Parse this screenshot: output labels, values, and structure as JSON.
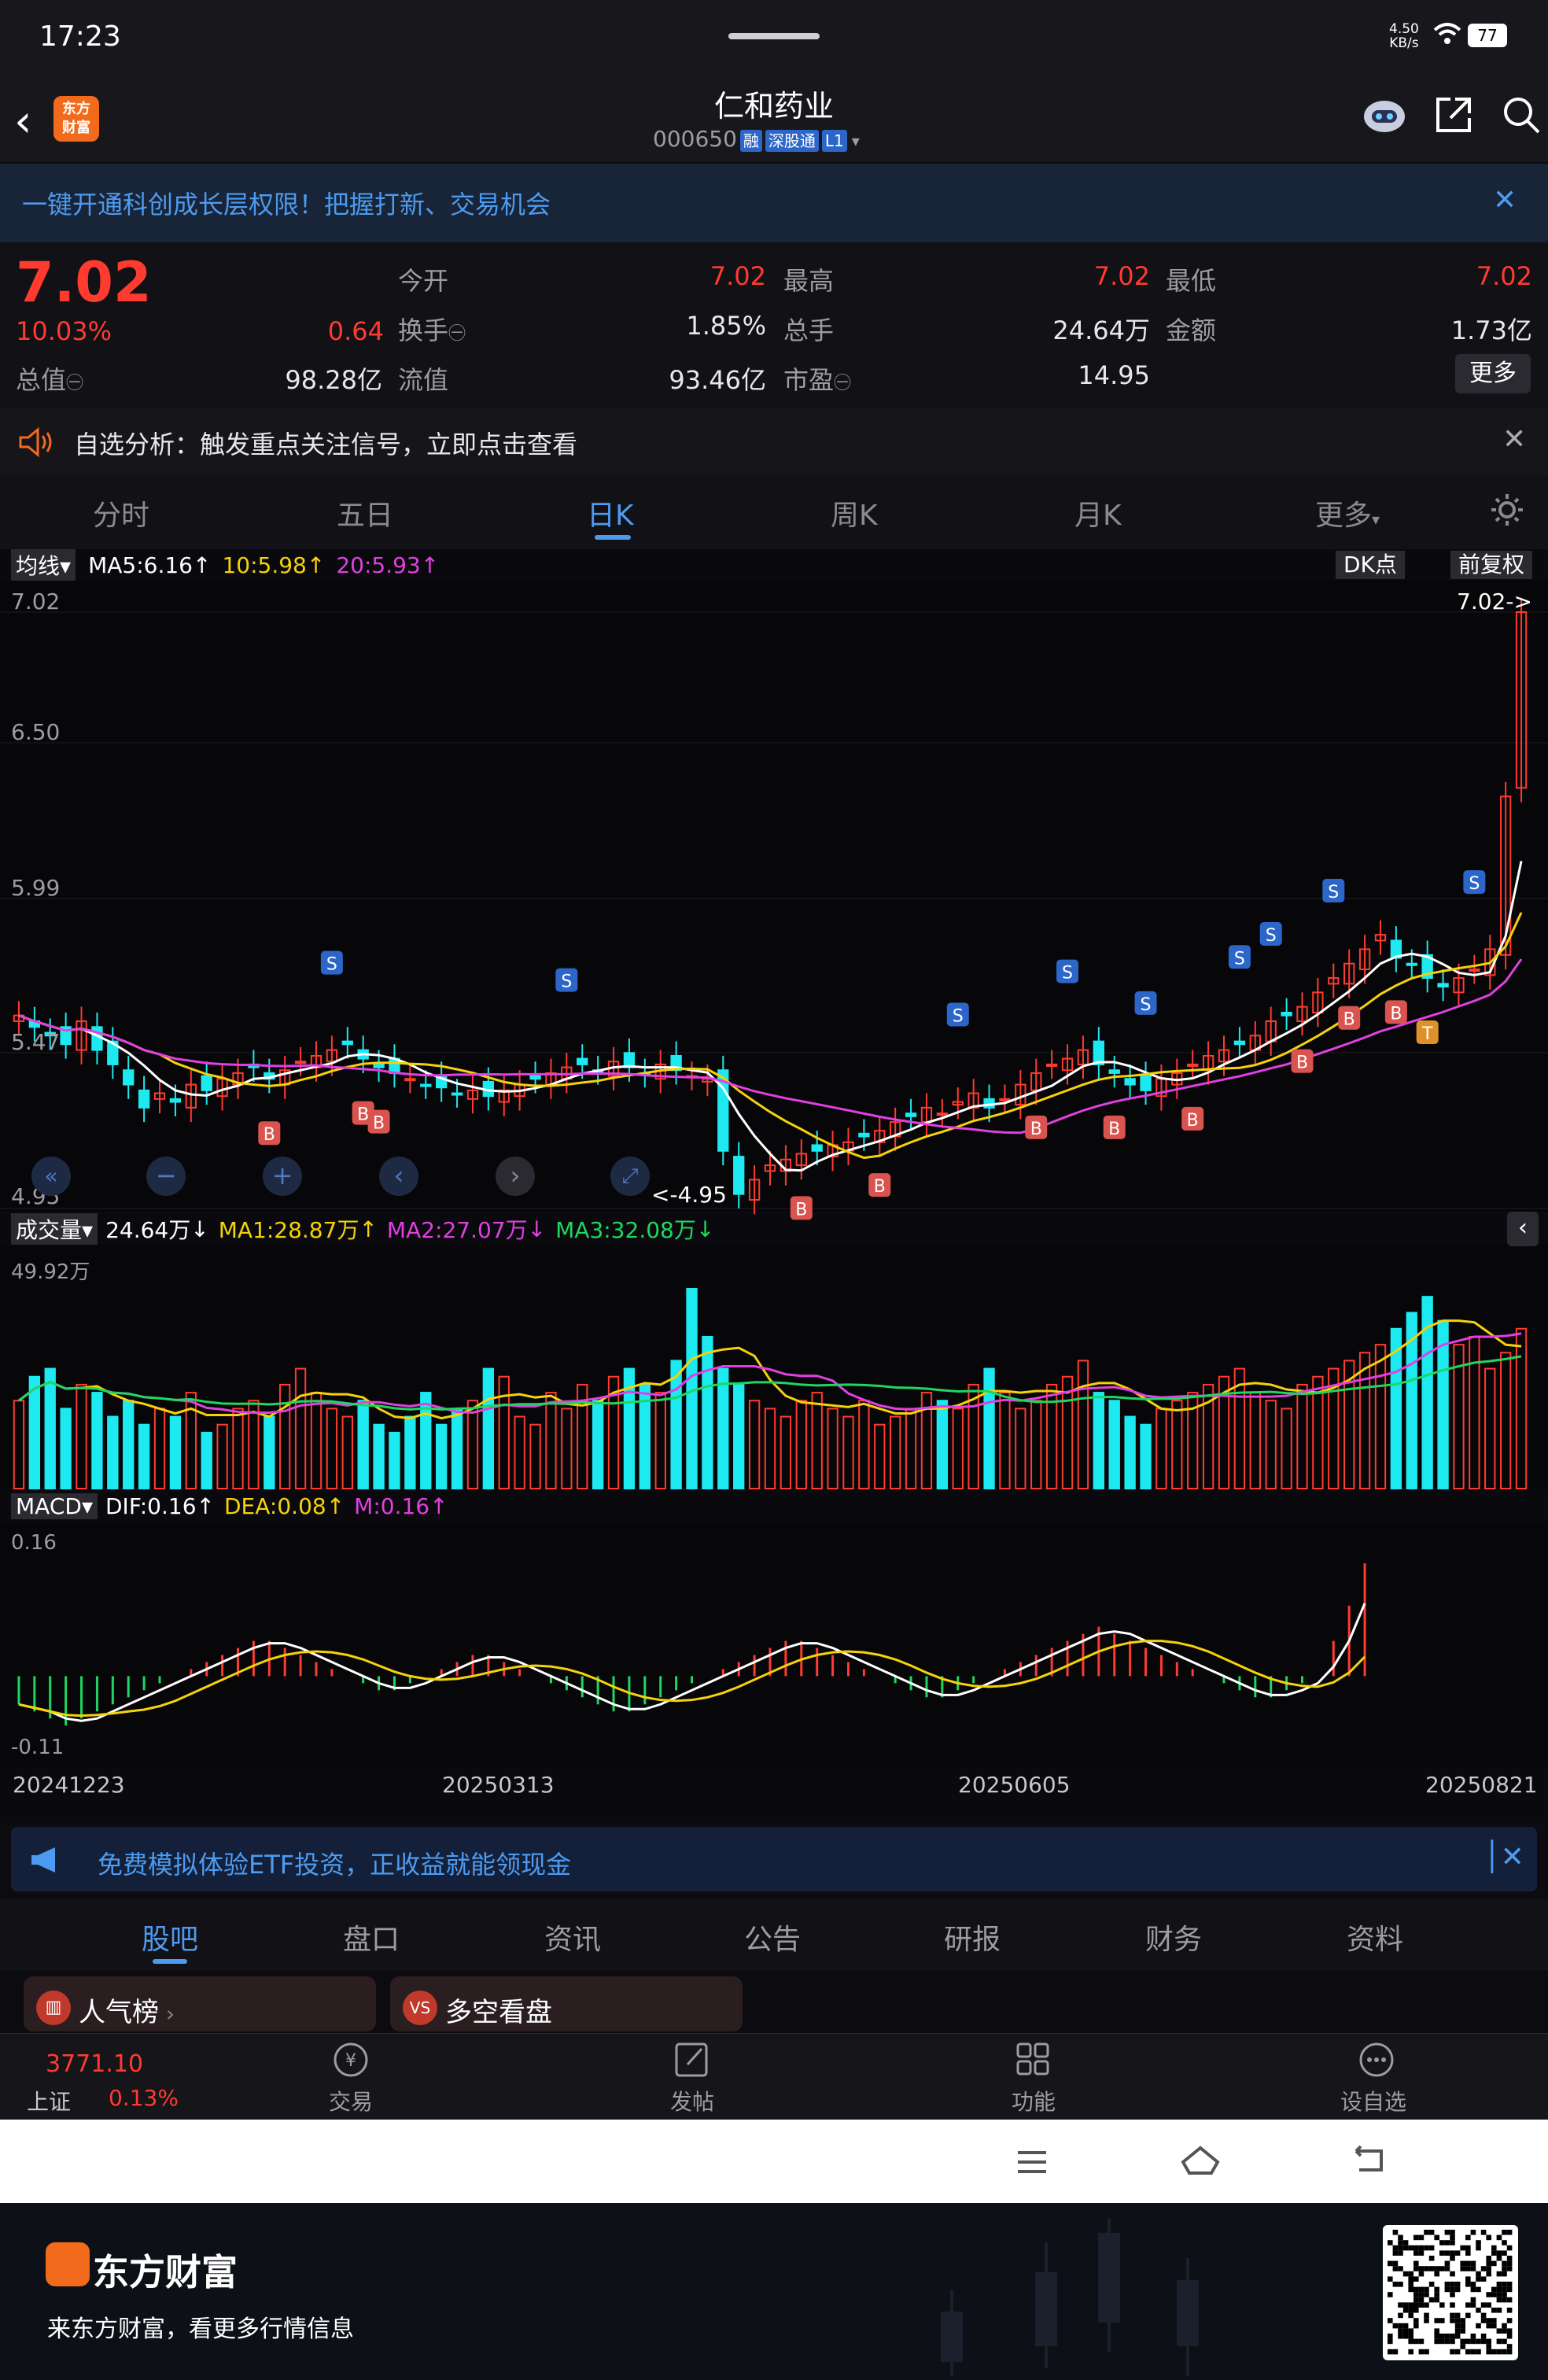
{
  "statusbar": {
    "time": "17:23",
    "net_speed": "4.50\nKB/s",
    "battery": "77"
  },
  "header": {
    "stock_name": "仁和药业",
    "stock_code": "000650",
    "tags": [
      "融",
      "深股通",
      "L1"
    ],
    "logo_text": "东方\n财富"
  },
  "promo": {
    "text": "一键开通科创成长层权限！把握打新、交易机会"
  },
  "quote": {
    "price": "7.02",
    "change_pct": "10.03%",
    "change_abs": "0.64",
    "fields": [
      {
        "label": "今开",
        "value": "7.02",
        "color": "red"
      },
      {
        "label": "最高",
        "value": "7.02",
        "color": "red"
      },
      {
        "label": "最低",
        "value": "7.02",
        "color": "red"
      },
      {
        "label": "换手",
        "value": "1.85%",
        "color": "white"
      },
      {
        "label": "总手",
        "value": "24.64万",
        "color": "white"
      },
      {
        "label": "金额",
        "value": "1.73亿",
        "color": "white"
      },
      {
        "label": "总值",
        "value": "98.28亿",
        "color": "white"
      },
      {
        "label": "流值",
        "value": "93.46亿",
        "color": "white"
      },
      {
        "label": "市盈",
        "value": "14.95",
        "color": "white"
      }
    ],
    "more": "更多"
  },
  "alert": {
    "text": "自选分析：触发重点关注信号，立即点击查看"
  },
  "tabs": [
    "分时",
    "五日",
    "日K",
    "周K",
    "月K",
    "更多"
  ],
  "active_tab": "日K",
  "chart_data": {
    "type": "candlestick",
    "title": "",
    "price_axis": {
      "ticks": [
        "7.02",
        "6.50",
        "5.99",
        "5.47",
        "4.95"
      ],
      "min": 4.95,
      "max": 7.02
    },
    "dates": [
      "20241223",
      "20250313",
      "20250605",
      "20250821"
    ],
    "legend_ma": {
      "label": "均线",
      "ma5": "MA5:6.16",
      "ma10": "10:5.98",
      "ma20": "20:5.93"
    },
    "dk_label": "DK点",
    "adjust_label": "前复权",
    "last_price_marker": "7.02->",
    "low_marker": "<-4.95",
    "close_series": [
      5.62,
      5.58,
      5.55,
      5.52,
      5.6,
      5.5,
      5.45,
      5.38,
      5.3,
      5.35,
      5.32,
      5.38,
      5.36,
      5.4,
      5.42,
      5.44,
      5.4,
      5.43,
      5.46,
      5.48,
      5.5,
      5.52,
      5.47,
      5.44,
      5.42,
      5.4,
      5.38,
      5.37,
      5.35,
      5.36,
      5.34,
      5.36,
      5.38,
      5.4,
      5.42,
      5.44,
      5.45,
      5.43,
      5.46,
      5.44,
      5.42,
      5.45,
      5.43,
      5.41,
      5.4,
      5.15,
      5.0,
      5.05,
      5.1,
      5.12,
      5.14,
      5.15,
      5.17,
      5.18,
      5.2,
      5.22,
      5.25,
      5.27,
      5.3,
      5.28,
      5.32,
      5.35,
      5.3,
      5.33,
      5.38,
      5.42,
      5.45,
      5.47,
      5.5,
      5.45,
      5.42,
      5.38,
      5.36,
      5.4,
      5.42,
      5.45,
      5.48,
      5.5,
      5.52,
      5.55,
      5.6,
      5.62,
      5.65,
      5.7,
      5.75,
      5.8,
      5.85,
      5.9,
      5.82,
      5.8,
      5.75,
      5.72,
      5.75,
      5.78,
      5.85,
      6.38,
      7.02
    ],
    "signals": {
      "B": 11,
      "S": 9,
      "T": 1
    },
    "volume": {
      "label": "成交量",
      "value": "24.64万",
      "ma1": "MA1:28.87万",
      "ma2": "MA2:27.07万",
      "ma3": "MA3:32.08万",
      "max_label": "49.92万"
    },
    "volume_series": [
      22,
      28,
      30,
      20,
      26,
      24,
      18,
      22,
      16,
      20,
      18,
      24,
      14,
      16,
      20,
      22,
      18,
      26,
      30,
      24,
      20,
      18,
      22,
      16,
      14,
      18,
      24,
      16,
      20,
      22,
      30,
      28,
      18,
      16,
      24,
      20,
      26,
      22,
      28,
      30,
      26,
      24,
      32,
      50,
      38,
      30,
      26,
      22,
      20,
      18,
      22,
      24,
      20,
      18,
      22,
      16,
      18,
      20,
      24,
      22,
      20,
      26,
      30,
      24,
      20,
      22,
      26,
      28,
      32,
      24,
      22,
      18,
      16,
      20,
      22,
      24,
      26,
      28,
      30,
      24,
      22,
      20,
      26,
      28,
      30,
      32,
      34,
      36,
      40,
      44,
      48,
      42,
      36,
      38,
      30,
      34,
      40
    ],
    "macd": {
      "label": "MACD",
      "dif": "DIF:0.16",
      "dea": "DEA:0.08",
      "m": "M:0.16",
      "max_label": "0.16",
      "min_label": "-0.11"
    },
    "macd_series": [
      -0.04,
      -0.05,
      -0.06,
      -0.07,
      -0.06,
      -0.05,
      -0.04,
      -0.03,
      -0.02,
      -0.01,
      0.0,
      0.01,
      0.02,
      0.03,
      0.04,
      0.05,
      0.05,
      0.04,
      0.03,
      0.02,
      0.01,
      0.0,
      -0.01,
      -0.02,
      -0.02,
      -0.01,
      0.0,
      0.01,
      0.02,
      0.03,
      0.03,
      0.02,
      0.01,
      0.0,
      -0.01,
      -0.02,
      -0.03,
      -0.04,
      -0.05,
      -0.05,
      -0.04,
      -0.03,
      -0.02,
      -0.01,
      0.0,
      0.01,
      0.02,
      0.03,
      0.04,
      0.05,
      0.05,
      0.04,
      0.03,
      0.02,
      0.01,
      0.0,
      -0.01,
      -0.02,
      -0.03,
      -0.03,
      -0.02,
      -0.01,
      0.0,
      0.01,
      0.02,
      0.03,
      0.04,
      0.05,
      0.06,
      0.07,
      0.06,
      0.05,
      0.04,
      0.03,
      0.02,
      0.01,
      0.0,
      -0.01,
      -0.02,
      -0.03,
      -0.03,
      -0.02,
      -0.01,
      0.0,
      0.05,
      0.1,
      0.16
    ],
    "colors": {
      "up": "#ff3b30",
      "down": "#1de9f0",
      "ma5": "#ffffff",
      "ma10": "#f5d20a",
      "ma20": "#e040e0",
      "ma3": "#1ed760"
    }
  },
  "chart_controls": [
    "zoom-out-left",
    "minus",
    "plus",
    "prev",
    "next",
    "expand"
  ],
  "ad": {
    "text": "免费模拟体验ETF投资，正收益就能领现金"
  },
  "subtabs": [
    "股吧",
    "盘口",
    "资讯",
    "公告",
    "研报",
    "财务",
    "资料"
  ],
  "active_subtab": "股吧",
  "cards": [
    {
      "label": "人气榜"
    },
    {
      "label": "多空看盘"
    }
  ],
  "bottomnav": {
    "index_value": "3771.10",
    "index_name": "上证",
    "index_change": "0.13%",
    "items": [
      "交易",
      "发帖",
      "功能",
      "设自选"
    ]
  },
  "footer": {
    "brand": "东方财富",
    "sub": "来东方财富，看更多行情信息"
  }
}
